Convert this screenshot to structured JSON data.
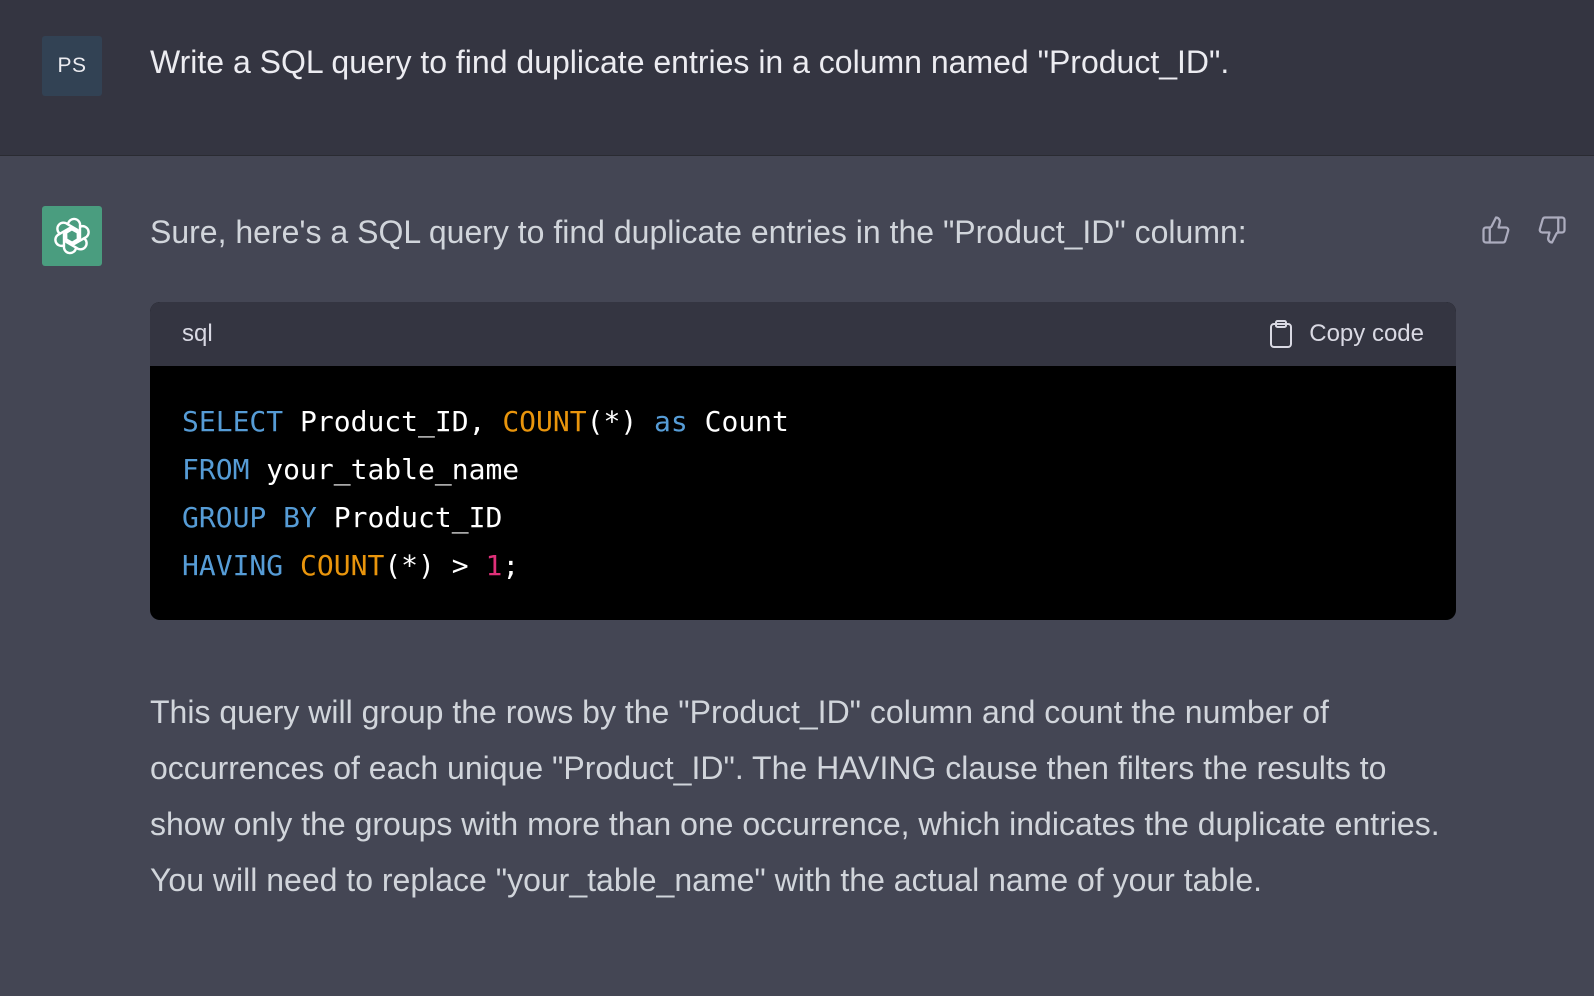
{
  "user": {
    "avatar_initials": "PS",
    "message": "Write a SQL query to find duplicate entries in a column named \"Product_ID\"."
  },
  "assistant": {
    "avatar_icon": "openai-logo-icon",
    "intro": "Sure, here's a SQL query to find duplicate entries in the \"Product_ID\" column:",
    "code": {
      "language": "sql",
      "copy_label": "Copy code",
      "lines": [
        [
          {
            "t": "SELECT",
            "c": "kw"
          },
          {
            "t": " Product_ID, ",
            "c": ""
          },
          {
            "t": "COUNT",
            "c": "fn"
          },
          {
            "t": "(*) ",
            "c": ""
          },
          {
            "t": "as",
            "c": "kw"
          },
          {
            "t": " Count",
            "c": ""
          }
        ],
        [
          {
            "t": "FROM",
            "c": "kw"
          },
          {
            "t": " your_table_name",
            "c": ""
          }
        ],
        [
          {
            "t": "GROUP",
            "c": "kw"
          },
          {
            "t": " ",
            "c": ""
          },
          {
            "t": "BY",
            "c": "kw"
          },
          {
            "t": " Product_ID",
            "c": ""
          }
        ],
        [
          {
            "t": "HAVING",
            "c": "kw"
          },
          {
            "t": " ",
            "c": ""
          },
          {
            "t": "COUNT",
            "c": "fn"
          },
          {
            "t": "(*) > ",
            "c": ""
          },
          {
            "t": "1",
            "c": "num"
          },
          {
            "t": ";",
            "c": ""
          }
        ]
      ]
    },
    "explanation": "This query will group the rows by the \"Product_ID\" column and count the number of occurrences of each unique \"Product_ID\". The HAVING clause then filters the results to show only the groups with more than one occurrence, which indicates the duplicate entries. You will need to replace \"your_table_name\" with the actual name of your table."
  },
  "feedback": {
    "up_icon": "thumbs-up-icon",
    "down_icon": "thumbs-down-icon"
  },
  "colors": {
    "user_bg": "#343541",
    "assistant_bg": "#444654",
    "user_avatar": "#324254",
    "assistant_avatar": "#4a9d7f",
    "keyword": "#569cd6",
    "function": "#e9950c",
    "number": "#df3079"
  }
}
